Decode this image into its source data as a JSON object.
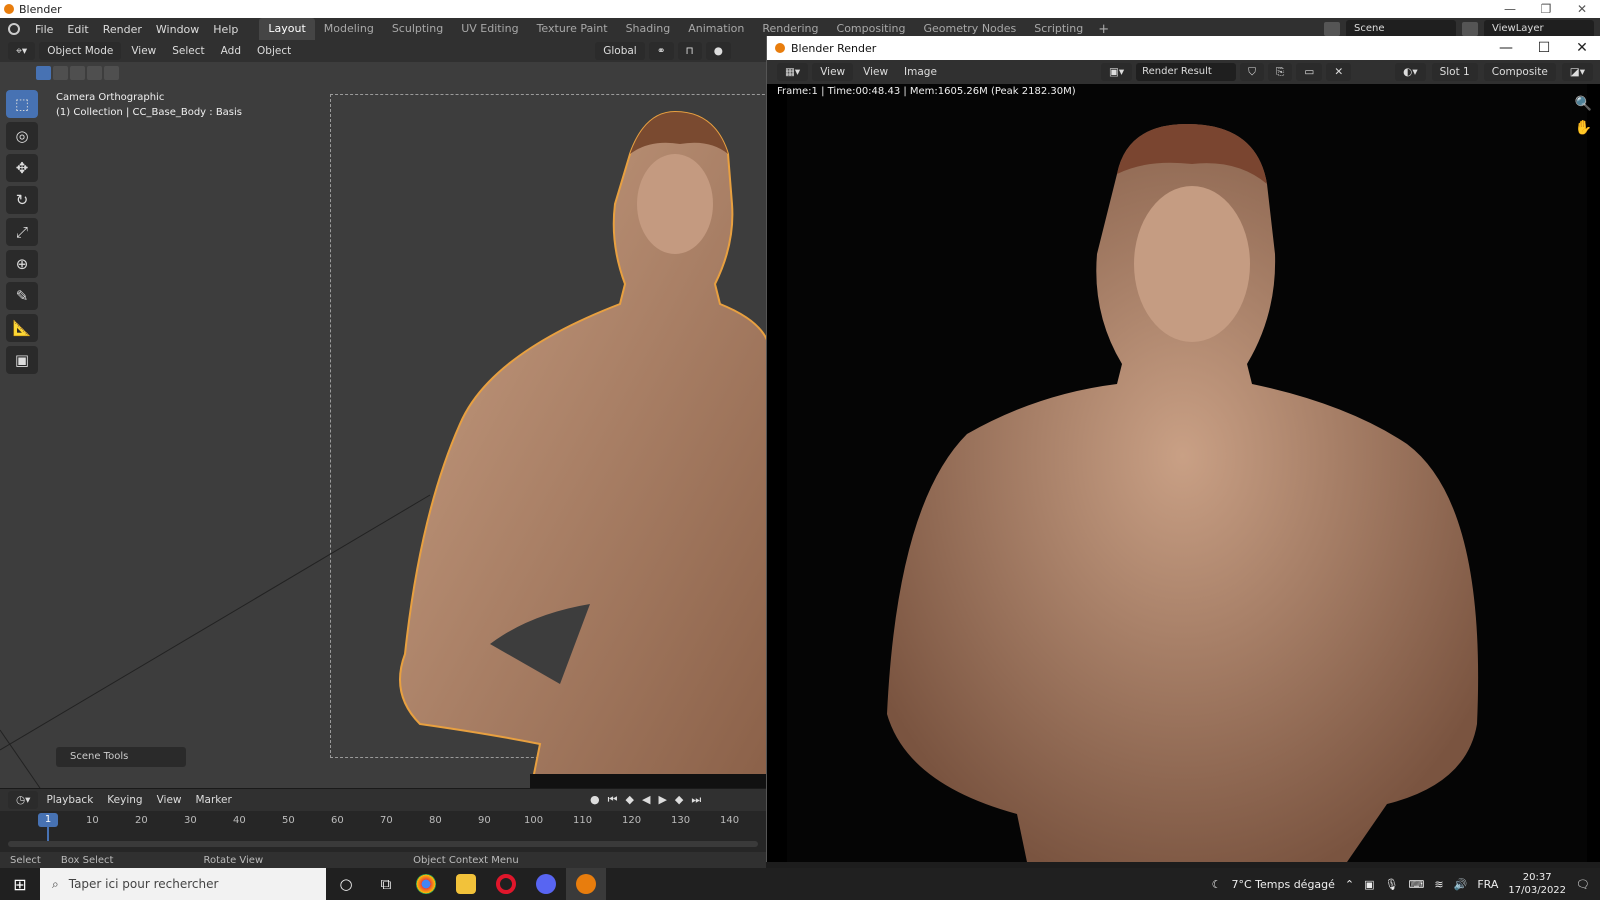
{
  "window": {
    "title": "Blender",
    "min": "—",
    "max": "❐",
    "close": "✕"
  },
  "menu": [
    "File",
    "Edit",
    "Render",
    "Window",
    "Help"
  ],
  "workspaces": [
    "Layout",
    "Modeling",
    "Sculpting",
    "UV Editing",
    "Texture Paint",
    "Shading",
    "Animation",
    "Rendering",
    "Compositing",
    "Geometry Nodes",
    "Scripting"
  ],
  "active_workspace": "Layout",
  "scene": {
    "scene_name": "Scene",
    "view_layer": "ViewLayer"
  },
  "viewport": {
    "mode": "Object Mode",
    "menus": [
      "View",
      "Select",
      "Add",
      "Object"
    ],
    "orientation": "Global",
    "info_line1": "Camera Orthographic",
    "info_line2": "(1) Collection | CC_Base_Body : Basis",
    "scene_tools": "Scene Tools",
    "tools": [
      "select-box-icon",
      "cursor-icon",
      "move-icon",
      "rotate-icon",
      "scale-icon",
      "transform-icon",
      "annotate-icon",
      "measure-icon",
      "add-cube-icon"
    ]
  },
  "render_window": {
    "title": "Blender Render",
    "menus": [
      "View",
      "View",
      "Image"
    ],
    "image_name": "Render Result",
    "slot": "Slot 1",
    "pass": "Composite",
    "stats": "Frame:1 | Time:00:48.43 | Mem:1605.26M (Peak 2182.30M)"
  },
  "timeline": {
    "menus": [
      "Playback",
      "Keying",
      "View",
      "Marker"
    ],
    "current_frame": "1",
    "ticks": [
      "10",
      "20",
      "30",
      "40",
      "50",
      "60",
      "70",
      "80",
      "90",
      "100",
      "110",
      "120",
      "130",
      "140"
    ]
  },
  "statusbar": {
    "select": "Select",
    "box_select": "Box Select",
    "rotate": "Rotate View",
    "context": "Object Context Menu"
  },
  "taskbar": {
    "search_placeholder": "Taper ici pour rechercher",
    "weather": "7°C  Temps dégagé",
    "lang": "FRA",
    "time": "20:37",
    "date": "17/03/2022"
  },
  "colors": {
    "accent": "#4772b3",
    "selection_outline": "#e8a040",
    "blender_orange": "#e87d0d"
  }
}
